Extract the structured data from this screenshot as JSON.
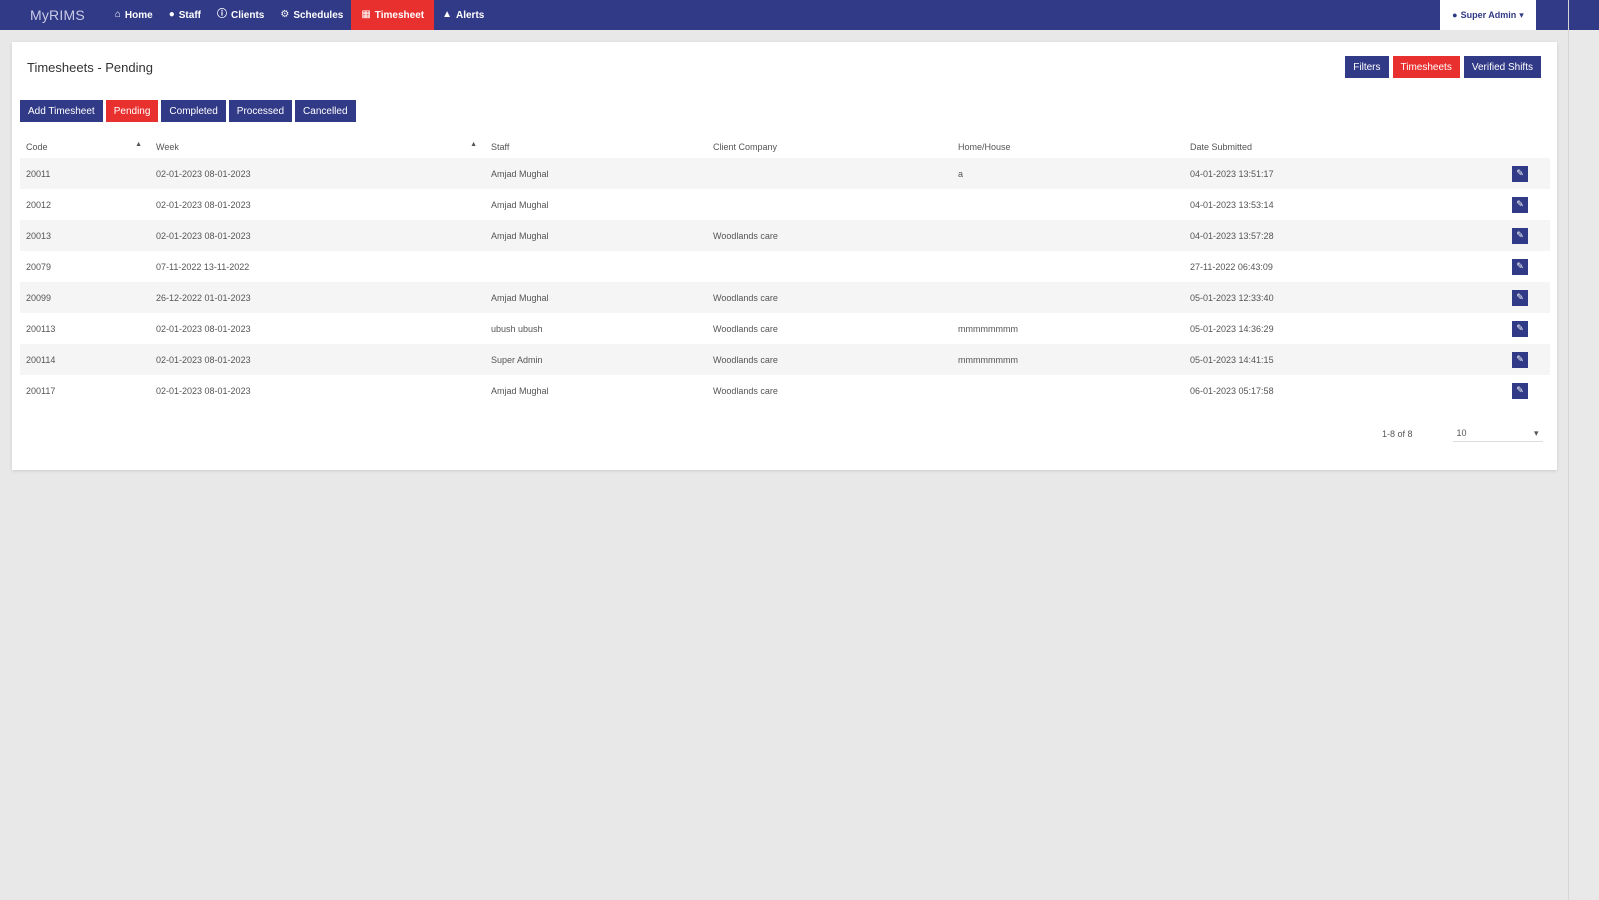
{
  "navbar": {
    "brand": "MyRIMS",
    "items": [
      {
        "label": "Home",
        "icon": "home-icon",
        "glyph": "⌂"
      },
      {
        "label": "Staff",
        "icon": "user-icon",
        "glyph": "●"
      },
      {
        "label": "Clients",
        "icon": "info-icon",
        "glyph": "ⓘ"
      },
      {
        "label": "Schedules",
        "icon": "gear-icon",
        "glyph": "⚙"
      },
      {
        "label": "Timesheet",
        "icon": "calendar-icon",
        "glyph": "▦",
        "active": true
      },
      {
        "label": "Alerts",
        "icon": "warning-icon",
        "glyph": "▲"
      }
    ],
    "user": {
      "label": "Super Admin",
      "icon": "user-icon",
      "glyph": "●",
      "caret": "▾"
    }
  },
  "page": {
    "title": "Timesheets - Pending",
    "actions": {
      "filters": "Filters",
      "timesheets": "Timesheets",
      "verified_shifts": "Verified Shifts"
    },
    "tabs": {
      "add": "Add Timesheet",
      "pending": "Pending",
      "completed": "Completed",
      "processed": "Processed",
      "cancelled": "Cancelled"
    }
  },
  "table": {
    "headers": {
      "code": "Code",
      "week": "Week",
      "staff": "Staff",
      "client_company": "Client Company",
      "home_house": "Home/House",
      "date_submitted": "Date Submitted"
    },
    "sort_glyph": "▲",
    "rows": [
      {
        "code": "20011",
        "week": "02-01-2023 08-01-2023",
        "staff": "Amjad Mughal",
        "company": "",
        "home": "a",
        "submitted": "04-01-2023 13:51:17"
      },
      {
        "code": "20012",
        "week": "02-01-2023 08-01-2023",
        "staff": "Amjad Mughal",
        "company": "",
        "home": "",
        "submitted": "04-01-2023 13:53:14"
      },
      {
        "code": "20013",
        "week": "02-01-2023 08-01-2023",
        "staff": "Amjad Mughal",
        "company": "Woodlands care",
        "home": "",
        "submitted": "04-01-2023 13:57:28"
      },
      {
        "code": "20079",
        "week": "07-11-2022 13-11-2022",
        "staff": "",
        "company": "",
        "home": "",
        "submitted": "27-11-2022 06:43:09"
      },
      {
        "code": "20099",
        "week": "26-12-2022 01-01-2023",
        "staff": "Amjad Mughal",
        "company": "Woodlands care",
        "home": "",
        "submitted": "05-01-2023 12:33:40"
      },
      {
        "code": "200113",
        "week": "02-01-2023 08-01-2023",
        "staff": "ubush ubush",
        "company": "Woodlands care",
        "home": "mmmmmmmm",
        "submitted": "05-01-2023 14:36:29"
      },
      {
        "code": "200114",
        "week": "02-01-2023 08-01-2023",
        "staff": "Super Admin",
        "company": "Woodlands care",
        "home": "mmmmmmmm",
        "submitted": "05-01-2023 14:41:15"
      },
      {
        "code": "200117",
        "week": "02-01-2023 08-01-2023",
        "staff": "Amjad Mughal",
        "company": "Woodlands care",
        "home": "",
        "submitted": "06-01-2023 05:17:58"
      }
    ],
    "row_action_glyph": "✎"
  },
  "pager": {
    "range": "1-8 of 8",
    "per_page": "10",
    "caret": "▾"
  },
  "colors": {
    "navbar": "#313a86",
    "accent": "#e8312f",
    "background": "#e8e8e8"
  }
}
